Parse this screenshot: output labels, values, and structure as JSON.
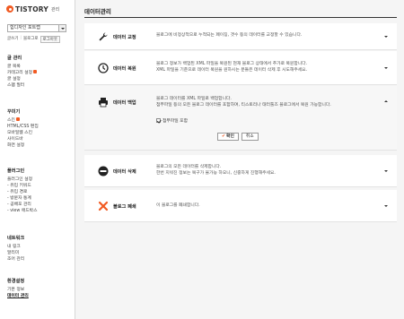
{
  "brand": {
    "name": "TISTORY",
    "section": "관리"
  },
  "blog_select": {
    "value": "힙디자인 포트랩"
  },
  "quick_links": {
    "write": "글쓰기",
    "view_blog": "블로그로",
    "logout": "로그아웃"
  },
  "sidebar": {
    "groups": [
      {
        "title": "글 관리",
        "items": [
          "글 목록",
          "카테고리 설정",
          "글 설정",
          "스팸 필터"
        ]
      },
      {
        "title": "꾸미기",
        "items": [
          "스킨",
          "HTML/CSS 편집",
          "모바일웹 스킨",
          "사이드바",
          "화면 설정"
        ]
      },
      {
        "title": "플러그인",
        "items": [
          "플러그인 설정",
          "- 유입 키워드",
          "- 유입 경로",
          "- 방문자 통계",
          "- 공배포 관리",
          "- view 애드박스"
        ]
      },
      {
        "title": "네트워크",
        "items": [
          "내 링크",
          "알리미",
          "조어 관리"
        ]
      },
      {
        "title": "환경설정",
        "items": [
          "기본 정보",
          "데이터 관리"
        ]
      }
    ]
  },
  "main": {
    "title": "데이터관리",
    "panels": [
      {
        "icon": "wrench-icon",
        "label": "데이터 교정",
        "desc": [
          "블로그에 비정상적으로 누적되는 페이징, 갯수 등의 데이터를 교정할 수 있습니다."
        ]
      },
      {
        "icon": "clock-icon",
        "label": "데이터 복원",
        "desc": [
          "블로그 정보가 백업된 XML 파일을 복원된 현재 블로그 상태에서 추가로 복원합니다.",
          "XML 파일을 기준으로 데이터 복원을 원하시는 분들은 데이터 삭제 후 시도해주세요."
        ]
      },
      {
        "icon": "printer-icon",
        "label": "데이터 백업",
        "desc": [
          "블로그 데이터를 XML 파일로 백업합니다.",
          "첨부파일 등의 모든 블로그 데이터를 포함하며, 티스토리나 태터툴즈 블로그에서 복원 가능합니다."
        ],
        "checkbox": "첨부파일 포함",
        "ok": "확인",
        "cancel": "취소"
      },
      {
        "icon": "minus-circle-icon",
        "label": "데이터 삭제",
        "desc": [
          "블로그의 모든 데이터를 삭제합니다.",
          "한번 지워진 정보는 복구가 불가능 하오니, 신중하게 진행해주세요."
        ]
      },
      {
        "icon": "x-icon",
        "label": "블로그 폐쇄",
        "desc": [
          "이 블로그를 폐쇄합니다."
        ]
      }
    ]
  },
  "colors": {
    "accent": "#f15a22"
  }
}
